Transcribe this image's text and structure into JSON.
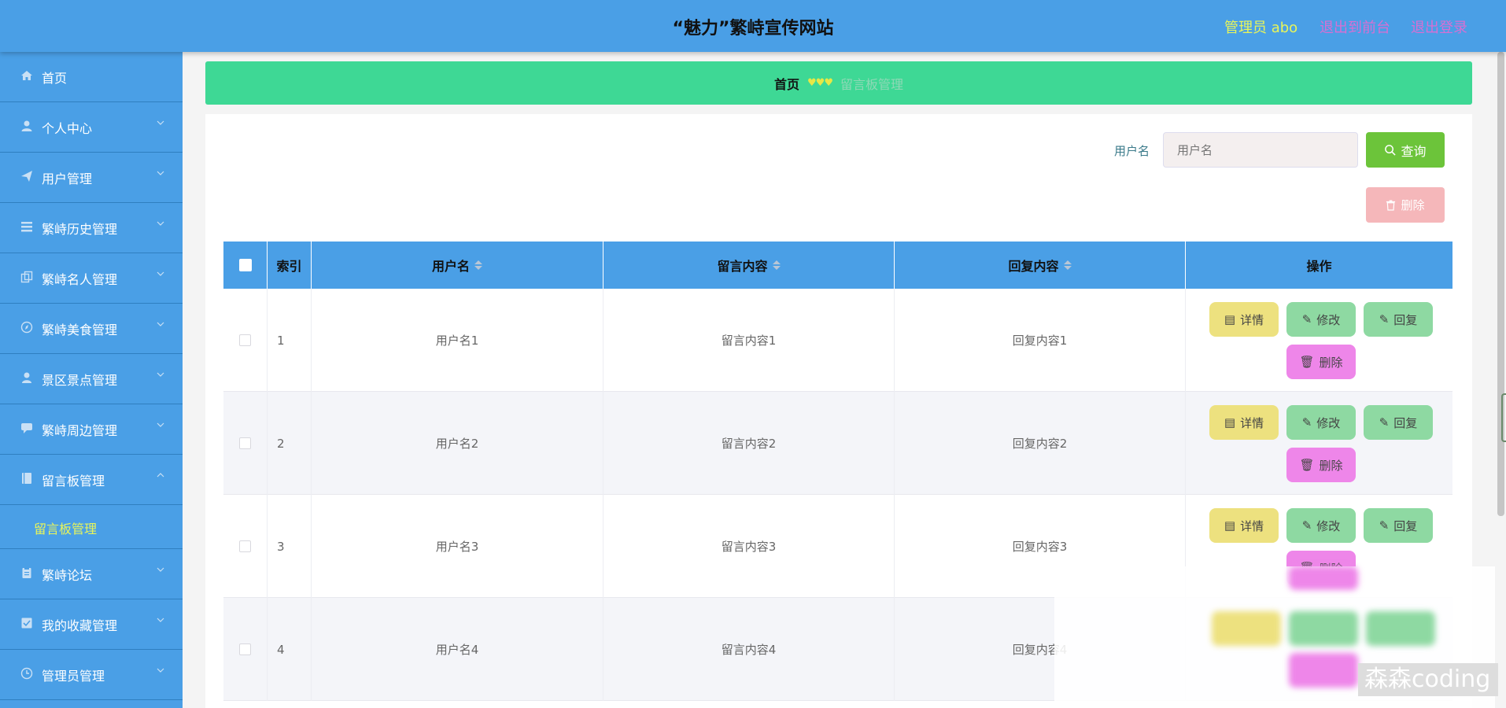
{
  "header": {
    "title": "“魅力”繁峙宣传网站",
    "user": "管理员 abo",
    "to_front": "退出到前台",
    "logout": "退出登录"
  },
  "sidebar": {
    "items": [
      {
        "label": "首页",
        "icon": "home-icon",
        "has_chevron": false
      },
      {
        "label": "个人中心",
        "icon": "user-icon",
        "has_chevron": true
      },
      {
        "label": "用户管理",
        "icon": "send-icon",
        "has_chevron": true
      },
      {
        "label": "繁峙历史管理",
        "icon": "list-icon",
        "has_chevron": true
      },
      {
        "label": "繁峙名人管理",
        "icon": "copy-icon",
        "has_chevron": true
      },
      {
        "label": "繁峙美食管理",
        "icon": "compass-icon",
        "has_chevron": true
      },
      {
        "label": "景区景点管理",
        "icon": "person-icon",
        "has_chevron": true
      },
      {
        "label": "繁峙周边管理",
        "icon": "chat-icon",
        "has_chevron": true
      },
      {
        "label": "留言板管理",
        "icon": "book-icon",
        "has_chevron": true,
        "expanded": true
      },
      {
        "label": "繁峙论坛",
        "icon": "clipboard-icon",
        "has_chevron": true
      },
      {
        "label": "我的收藏管理",
        "icon": "checkbox-icon",
        "has_chevron": true
      },
      {
        "label": "管理员管理",
        "icon": "clock-icon",
        "has_chevron": true
      }
    ],
    "sub_item": "留言板管理"
  },
  "breadcrumb": {
    "home": "首页",
    "separator": "♥♥♥",
    "current": "留言板管理"
  },
  "search": {
    "label": "用户名",
    "placeholder": "用户名",
    "button": "查询"
  },
  "batch_delete": "删除",
  "table": {
    "columns": [
      "索引",
      "用户名",
      "留言内容",
      "回复内容",
      "操作"
    ],
    "rows": [
      {
        "index": "1",
        "username": "用户名1",
        "message": "留言内容1",
        "reply": "回复内容1"
      },
      {
        "index": "2",
        "username": "用户名2",
        "message": "留言内容2",
        "reply": "回复内容2"
      },
      {
        "index": "3",
        "username": "用户名3",
        "message": "留言内容3",
        "reply": "回复内容3"
      },
      {
        "index": "4",
        "username": "用户名4",
        "message": "留言内容4",
        "reply": "回复内容4"
      }
    ],
    "actions": {
      "detail": "详情",
      "edit": "修改",
      "reply": "回复",
      "delete": "删除"
    }
  },
  "watermark": "森森coding",
  "colors": {
    "header": "#4a9fe6",
    "breadcrumb": "#3ed895",
    "search_button": "#6cc43a",
    "detail": "#ede17f",
    "edit": "#8ed9a2",
    "delete": "#ee86e9",
    "accent_text": "#e8f55a"
  }
}
